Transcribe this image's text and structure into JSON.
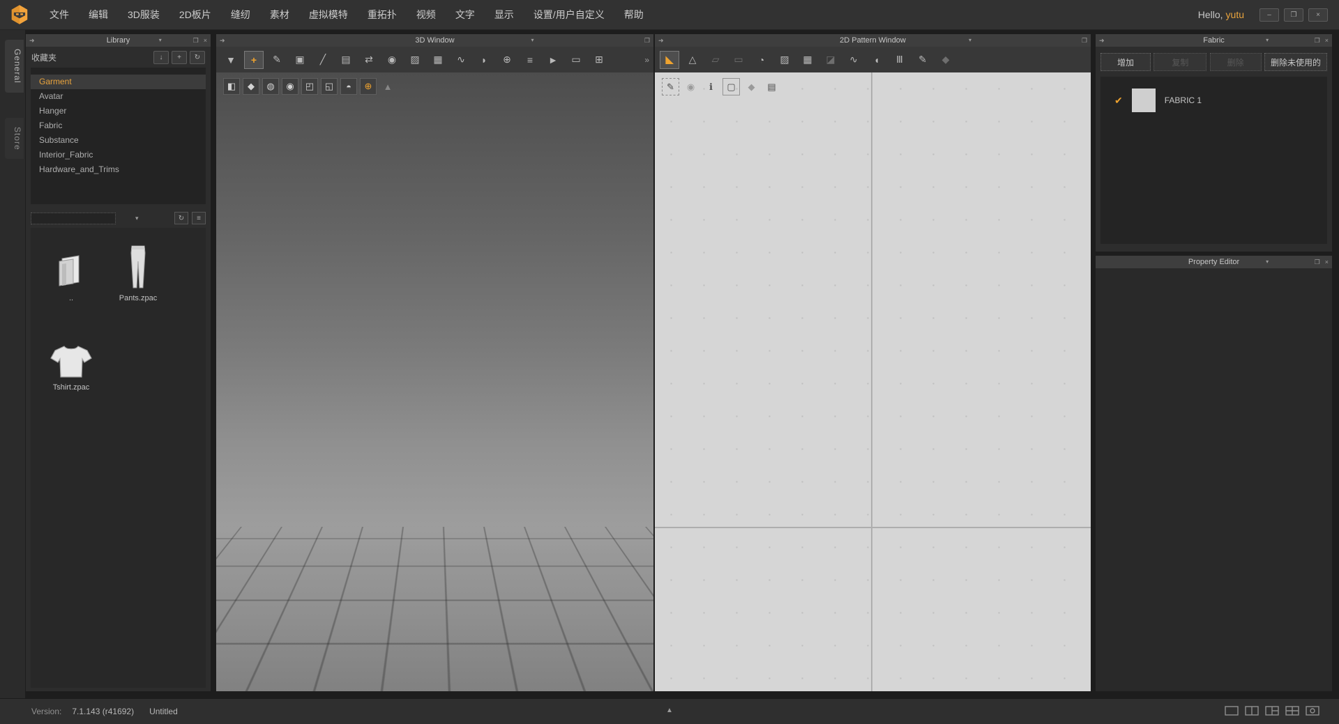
{
  "icons": {
    "dock_arrow": "➜",
    "dropdown": "▾",
    "float": "❐",
    "close": "×",
    "minimize": "–",
    "restore": "❐",
    "import": "↓",
    "add": "+",
    "refresh": "↻",
    "list_view": "≡",
    "check": "✔",
    "expand": "▲",
    "more": "»"
  },
  "menubar": {
    "hello": "Hello,",
    "user": "yutu",
    "items": [
      "文件",
      "编辑",
      "3D服装",
      "2D板片",
      "缝纫",
      "素材",
      "虚拟模特",
      "重拓扑",
      "视频",
      "文字",
      "显示",
      "设置/用户自定义",
      "帮助"
    ]
  },
  "side_tabs": {
    "general": "General",
    "store": "Store"
  },
  "library": {
    "title": "Library",
    "favorites_label": "收藏夹",
    "search_placeholder": "",
    "items": [
      {
        "label": "Garment",
        "selected": true
      },
      {
        "label": "Avatar"
      },
      {
        "label": "Hanger"
      },
      {
        "label": "Fabric"
      },
      {
        "label": "Substance"
      },
      {
        "label": "Interior_Fabric"
      },
      {
        "label": "Hardware_and_Trims"
      }
    ],
    "thumbnails": [
      {
        "label": ".."
      },
      {
        "label": "Pants.zpac"
      },
      {
        "label": "Tshirt.zpac"
      }
    ]
  },
  "window3d": {
    "title": "3D Window",
    "toolbar": [
      {
        "name": "simulate",
        "glyph": "▼"
      },
      {
        "name": "select-move",
        "glyph": "+",
        "active": true
      },
      {
        "name": "select-mesh",
        "glyph": "✎"
      },
      {
        "name": "select-pin",
        "glyph": "▣"
      },
      {
        "name": "pin",
        "glyph": "╱"
      },
      {
        "name": "fold-arrangement",
        "glyph": "▤"
      },
      {
        "name": "flip-fold",
        "glyph": "⇄"
      },
      {
        "name": "arrangement-points",
        "glyph": "◉"
      },
      {
        "name": "sewing",
        "glyph": "▨"
      },
      {
        "name": "quad-mesh",
        "glyph": "▦"
      },
      {
        "name": "steam-brush",
        "glyph": "∿"
      },
      {
        "name": "fitting",
        "glyph": "◗"
      },
      {
        "name": "button",
        "glyph": "⊕"
      },
      {
        "name": "zipper",
        "glyph": "≡"
      },
      {
        "name": "trim",
        "glyph": "►"
      },
      {
        "name": "hardware",
        "glyph": "▭"
      },
      {
        "name": "gizmo",
        "glyph": "⊞"
      }
    ],
    "overlay": [
      {
        "name": "show-garment",
        "glyph": "◧"
      },
      {
        "name": "show-tshirt",
        "glyph": "◆"
      },
      {
        "name": "show-texture",
        "glyph": "◍"
      },
      {
        "name": "show-avatar",
        "glyph": "◉"
      },
      {
        "name": "show-arrangement",
        "glyph": "◰"
      },
      {
        "name": "show-fold",
        "glyph": "◱"
      },
      {
        "name": "show-head",
        "glyph": "◓"
      },
      {
        "name": "show-environment",
        "glyph": "⊕",
        "active": true
      },
      {
        "name": "drop-platform",
        "glyph": "▲",
        "plain": true
      }
    ]
  },
  "window2d": {
    "title": "2D Pattern Window",
    "toolbar": [
      {
        "name": "transform-pattern",
        "glyph": "◣",
        "active": true
      },
      {
        "name": "edit-pattern",
        "glyph": "△"
      },
      {
        "name": "edit-polygon",
        "glyph": "▱",
        "dim": true
      },
      {
        "name": "add-rectangle",
        "glyph": "▭",
        "dim": true
      },
      {
        "name": "trace-avatar",
        "glyph": "◔"
      },
      {
        "name": "sewing-2d",
        "glyph": "▨"
      },
      {
        "name": "quad-2d",
        "glyph": "▦"
      },
      {
        "name": "iron",
        "glyph": "◪",
        "dim": true
      },
      {
        "name": "free-sewing",
        "glyph": "∿"
      },
      {
        "name": "sewing-foot",
        "glyph": "◖"
      },
      {
        "name": "pleats",
        "glyph": "Ⅲ"
      },
      {
        "name": "pen",
        "glyph": "✎"
      },
      {
        "name": "show-garment-2d",
        "glyph": "◆",
        "dim": true
      }
    ],
    "overlay": [
      {
        "name": "show-stitch",
        "glyph": "✎",
        "dashed": true
      },
      {
        "name": "show-points",
        "glyph": "◉",
        "dim": true
      },
      {
        "name": "pattern-info",
        "glyph": "ℹ"
      },
      {
        "name": "show-outline",
        "glyph": "▢",
        "boxed": true
      },
      {
        "name": "lock-pattern",
        "glyph": "◆",
        "dim": true
      },
      {
        "name": "measure",
        "glyph": "▤"
      }
    ]
  },
  "fabric": {
    "title": "Fabric",
    "buttons": [
      {
        "label": "增加",
        "enabled": true
      },
      {
        "label": "复制",
        "enabled": false
      },
      {
        "label": "删除",
        "enabled": false
      },
      {
        "label": "删除未使用的",
        "enabled": true
      }
    ],
    "items": [
      {
        "name": "FABRIC 1",
        "checked": true
      }
    ]
  },
  "property_editor": {
    "title": "Property Editor"
  },
  "statusbar": {
    "version_label": "Version:",
    "version_value": "7.1.143 (r41692)",
    "document_name": "Untitled",
    "layout_icons": [
      "layout-single",
      "layout-split-2",
      "layout-split-3",
      "layout-grid-4",
      "layout-floating"
    ]
  },
  "colors": {
    "accent": "#efa32f",
    "selection_text": "#e8a33d"
  }
}
